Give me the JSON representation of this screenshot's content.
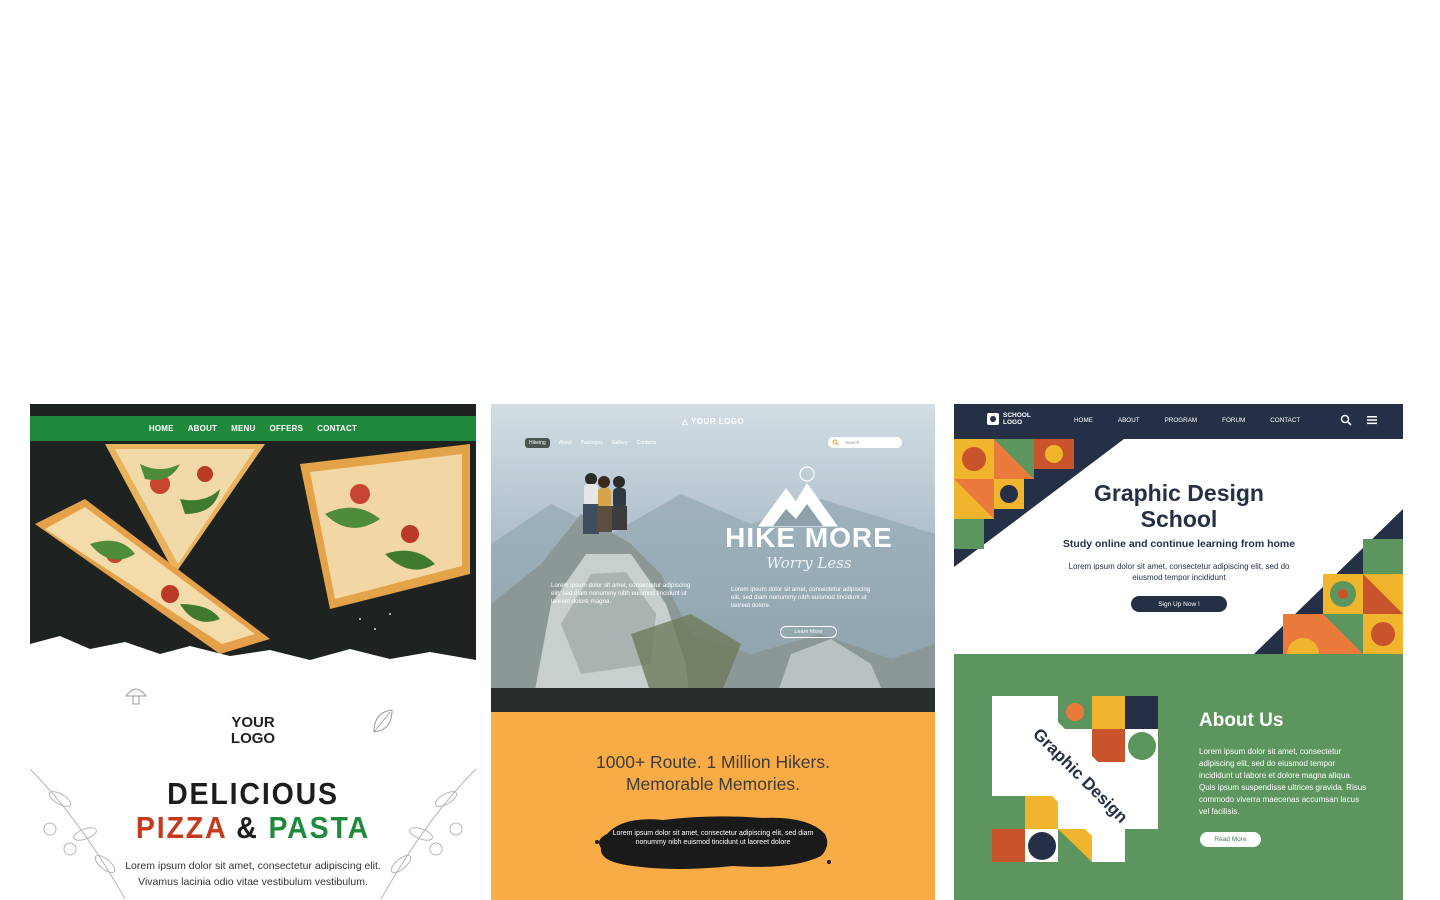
{
  "pizza": {
    "nav": [
      "HOME",
      "ABOUT",
      "MENU",
      "OFFERS",
      "CONTACT"
    ],
    "logo_line1": "YOUR",
    "logo_line2": "LOGO",
    "headline_1": "DELICIOUS",
    "headline_2a": "PIZZA",
    "headline_2b": "&",
    "headline_2c": "PASTA",
    "body_line1": "Lorem ipsum dolor sit amet, consectetur adipiscing elit.",
    "body_line2": "Vivamus lacinia odio vitae vestibulum vestibulum.",
    "colors": {
      "green": "#1f8a3c",
      "red": "#c5391d",
      "dark": "#1d1d1d"
    }
  },
  "hike": {
    "logo": "YOUR LOGO",
    "nav": [
      "Hikeing",
      "About",
      "Packages",
      "Gallery",
      "Contacts"
    ],
    "search_placeholder": "Search",
    "title": "HIKE MORE",
    "subtitle": "Worry Less",
    "para_left": "Lorem ipsum dolor sit amet, consectetur adipiscing elit, sed diam nonummy nibh euismod tincidunt ut laoreet dolore magna.",
    "para_right": "Lorem ipsum dolor sit amet, consectetur adipiscing elit, sed diam nonummy nibh euismod tincidunt ut laoreet dolore.",
    "button": "Learn More",
    "tagline_1": "1000+ Route. 1 Million Hikers.",
    "tagline_2": "Memorable Memories.",
    "blob_text": "Lorem ipsum dolor sit amet, consectetur adipiscing elit, sed diam nonummy nibh euismod tincidunt ut laoreet dolore",
    "colors": {
      "orange": "#f9ac45"
    }
  },
  "school": {
    "logo_1": "SCHOOL",
    "logo_2": "LOGO",
    "nav": [
      "HOME",
      "ABOUT",
      "PROGRAM",
      "FORUM",
      "CONTACT"
    ],
    "title_1": "Graphic Design",
    "title_2": "School",
    "subtitle": "Study online and continue learning from home",
    "paragraph": "Lorem ipsum dolor sit amet, consectetur adipiscing elit, sed do eiusmod tempor incididunt",
    "button": "Sign Up Now !",
    "about_title": "About Us",
    "about_text": "Lorem ipsum dolor sit amet, consectetur adipiscing elit, sed do eiusmod tempor incididunt ut labore et dolore magna aliqua. Quis ipsum suspendisse ultrices gravida. Risus commodo viverra maecenas accumsan lacus vel facilisis.",
    "about_button": "Read More",
    "image_label": "Graphic Design",
    "colors": {
      "navy": "#253047",
      "green": "#5c955e"
    }
  }
}
